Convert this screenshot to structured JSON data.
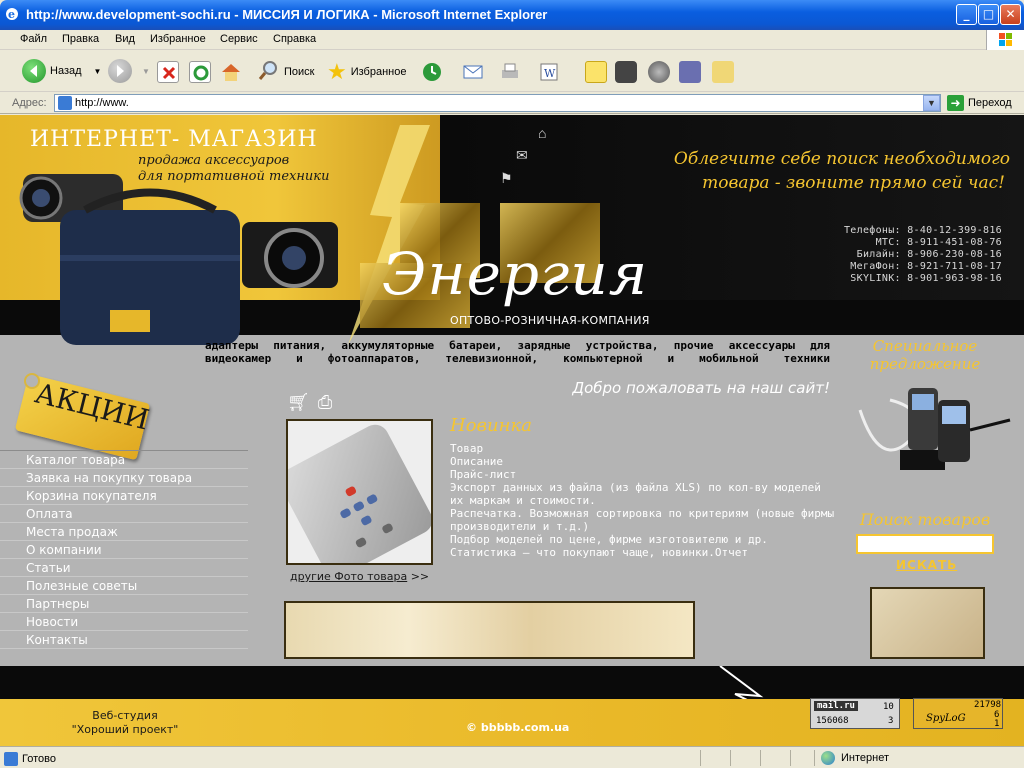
{
  "window": {
    "title": "http://www.development-sochi.ru - МИССИЯ И ЛОГИКА - Microsoft Internet Explorer",
    "minimize": "_",
    "maximize": "□",
    "close": "✕"
  },
  "menu": {
    "items": [
      "Файл",
      "Правка",
      "Вид",
      "Избранное",
      "Сервис",
      "Справка"
    ]
  },
  "toolbar": {
    "back_label": "Назад",
    "search_label": "Поиск",
    "favorites_label": "Избранное"
  },
  "address": {
    "label": "Адрес:",
    "url": "http://www.",
    "go_label": "Переход"
  },
  "header": {
    "shop_title": "ИНТЕРНЕТ- МАГАЗИН",
    "shop_sub1": "продажа аксессуаров",
    "shop_sub2": "для портативной техники",
    "slogan_line1": "Облегчите себе поиск необходимого",
    "slogan_line2": "товара - звоните прямо сей час!",
    "phones": [
      "Телефоны: 8-40-12-399-816",
      "МТС: 8-911-451-08-76",
      "Билайн: 8-906-230-08-16",
      "МегаФон: 8-921-711-08-17",
      "SKYLINK: 8-901-963-98-16"
    ],
    "logo": "Энергия",
    "logo_sub": "ОПТОВО-РОЗНИЧНАЯ-КОМПАНИЯ"
  },
  "tagline": "адаптеры питания, аккумуляторные батареи, зарядные устройства, прочие аксессуары для видеокамер и фотоаппаратов, телевизионной, компьютерной и мобильной техники",
  "welcome": "Добро пожаловать на наш сайт!",
  "promo_tag": "АКЦИИ",
  "nav": {
    "items": [
      "Каталог товара",
      "Заявка на покупку товара",
      "Корзина покупателя",
      "Оплата",
      "Места продаж",
      "О компании",
      "Статьи",
      "Полезные советы",
      "Партнеры",
      "Новости",
      "Контакты"
    ]
  },
  "main": {
    "section_title": "Новинка",
    "product_lines": [
      "Товар",
      "Описание",
      "Прайс-лист",
      "Экспорт данных из файла (из файла XLS) по кол-ву моделей их маркам и стоимости.",
      "Распечатка. Возможная сортировка по критериям (новые фирмы производители и т.д.)",
      "Подбор моделей по цене, фирме изготовителю и др.",
      "Статистика – что покупают чаще, новинки.Отчет"
    ],
    "more_photos_link": "другие Фото товара",
    "more_photos_suffix": ">>"
  },
  "sidebar": {
    "special_title": "Специальное предложение",
    "search_title": "Поиск товаров",
    "search_value": "",
    "search_button": "ИСКАТЬ"
  },
  "footer": {
    "studio_line1": "Веб-студия",
    "studio_line2": "\"Хороший проект\"",
    "copyright": "© bbbbb.com.ua",
    "mailru_label": "mail.ru",
    "mailru_n1": "10",
    "mailru_n2": "156068",
    "mailru_n3": "3",
    "spylog_label": "SpyLoG",
    "spylog_n1": "21798",
    "spylog_n2": "6",
    "spylog_n3": "1"
  },
  "status": {
    "text": "Готово",
    "zone": "Интернет"
  },
  "colors": {
    "accent_yellow": "#f5c530",
    "page_gray": "#b4b4b4",
    "xp_blue": "#0a5ee0"
  }
}
